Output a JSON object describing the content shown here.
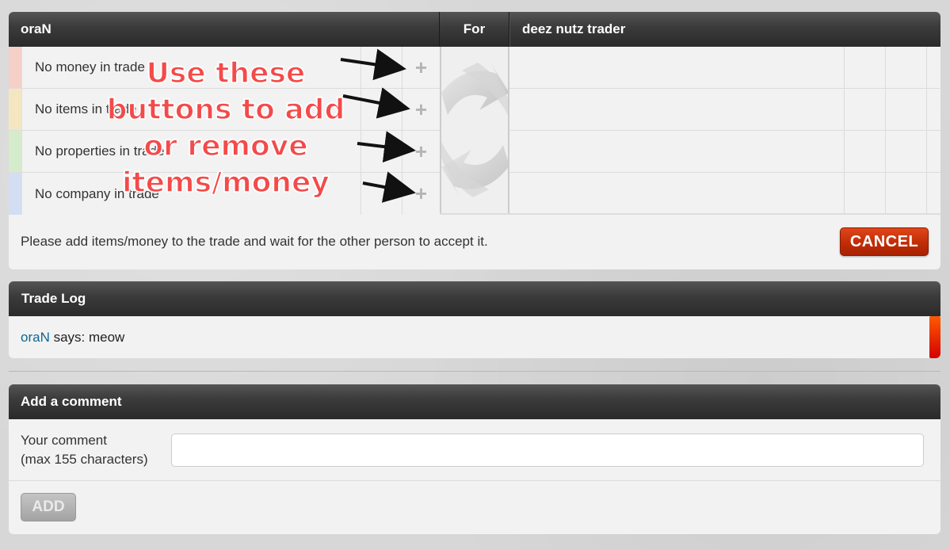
{
  "trade": {
    "header": {
      "left_user": "oraN",
      "middle": "For",
      "right_user": "deez nutz trader"
    },
    "rows": [
      {
        "label": "No money in trade",
        "color": "#f6cfc8",
        "add": "+"
      },
      {
        "label": "No items in trade",
        "color": "#f5e6c2",
        "add": "+"
      },
      {
        "label": "No properties in trade",
        "color": "#d4eccb",
        "add": "+"
      },
      {
        "label": "No company in trade",
        "color": "#d3def3",
        "add": "+"
      }
    ],
    "footer_message": "Please add items/money to the trade and wait for the other person to accept it.",
    "cancel_label": "CANCEL"
  },
  "log": {
    "title": "Trade Log",
    "entry": {
      "name": "oraN",
      "text": " says: meow"
    }
  },
  "comment": {
    "title": "Add a comment",
    "label_line1": "Your comment",
    "label_line2": "(max 155 characters)",
    "input_value": "",
    "add_label": "ADD"
  },
  "annotation": {
    "line1": "Use these",
    "line2": "buttons to add",
    "line3": "or remove",
    "line4": "items/money"
  }
}
